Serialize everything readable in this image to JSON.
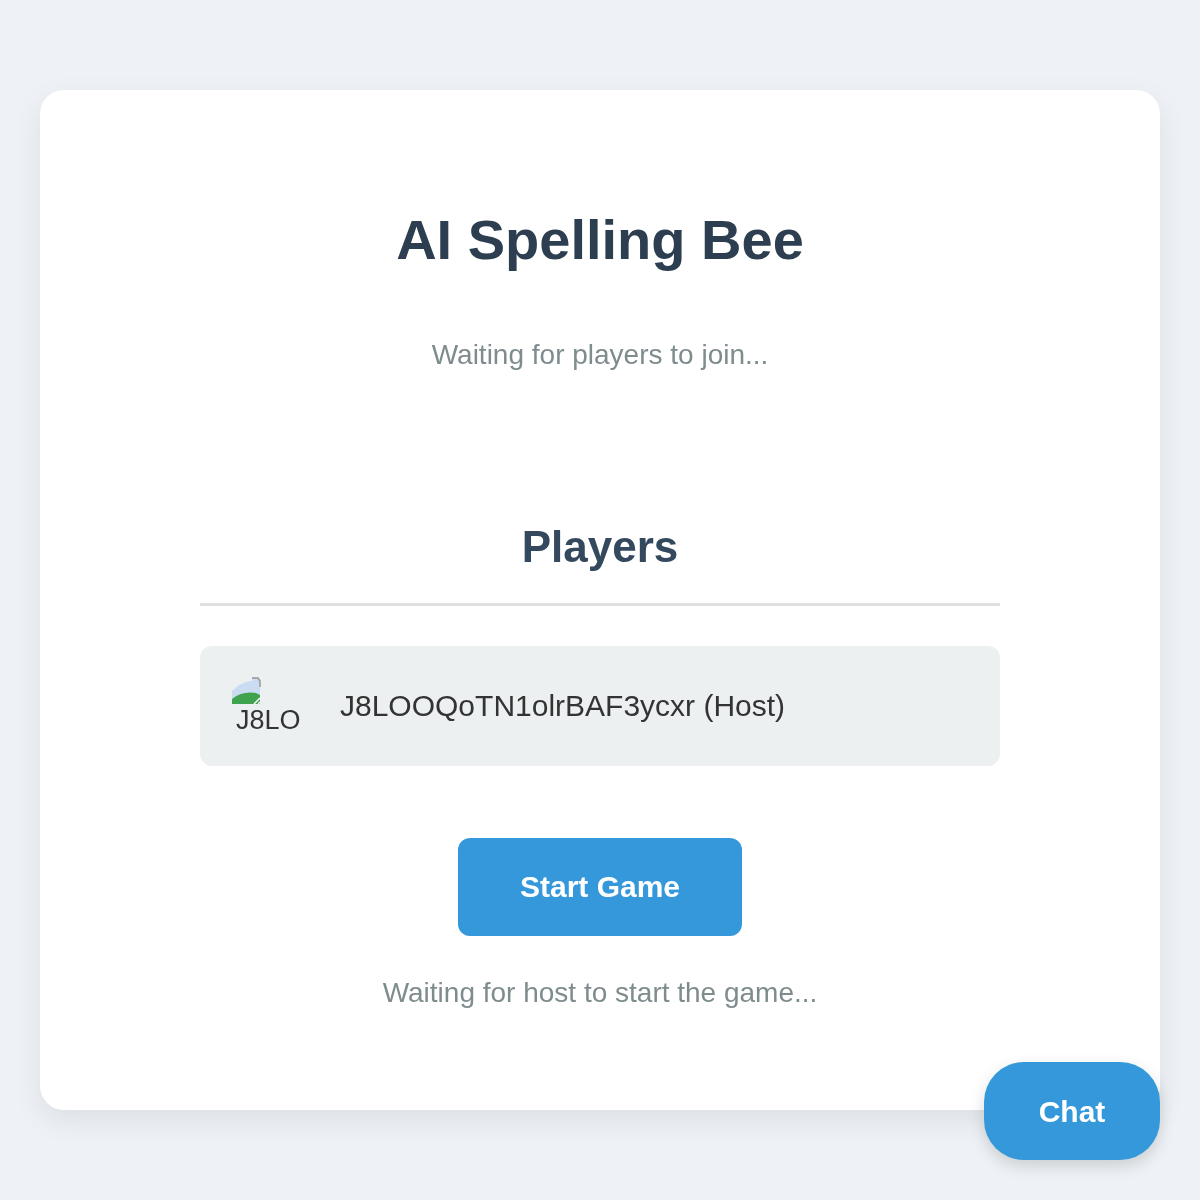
{
  "title": "AI Spelling Bee",
  "status": "Waiting for players to join...",
  "players_section": {
    "heading": "Players",
    "players": [
      {
        "avatar_alt": "J8LO",
        "name": "J8LOOQoTN1olrBAF3ycxr (Host)"
      }
    ]
  },
  "start_button": "Start Game",
  "host_status": "Waiting for host to start the game...",
  "chat_button": "Chat"
}
